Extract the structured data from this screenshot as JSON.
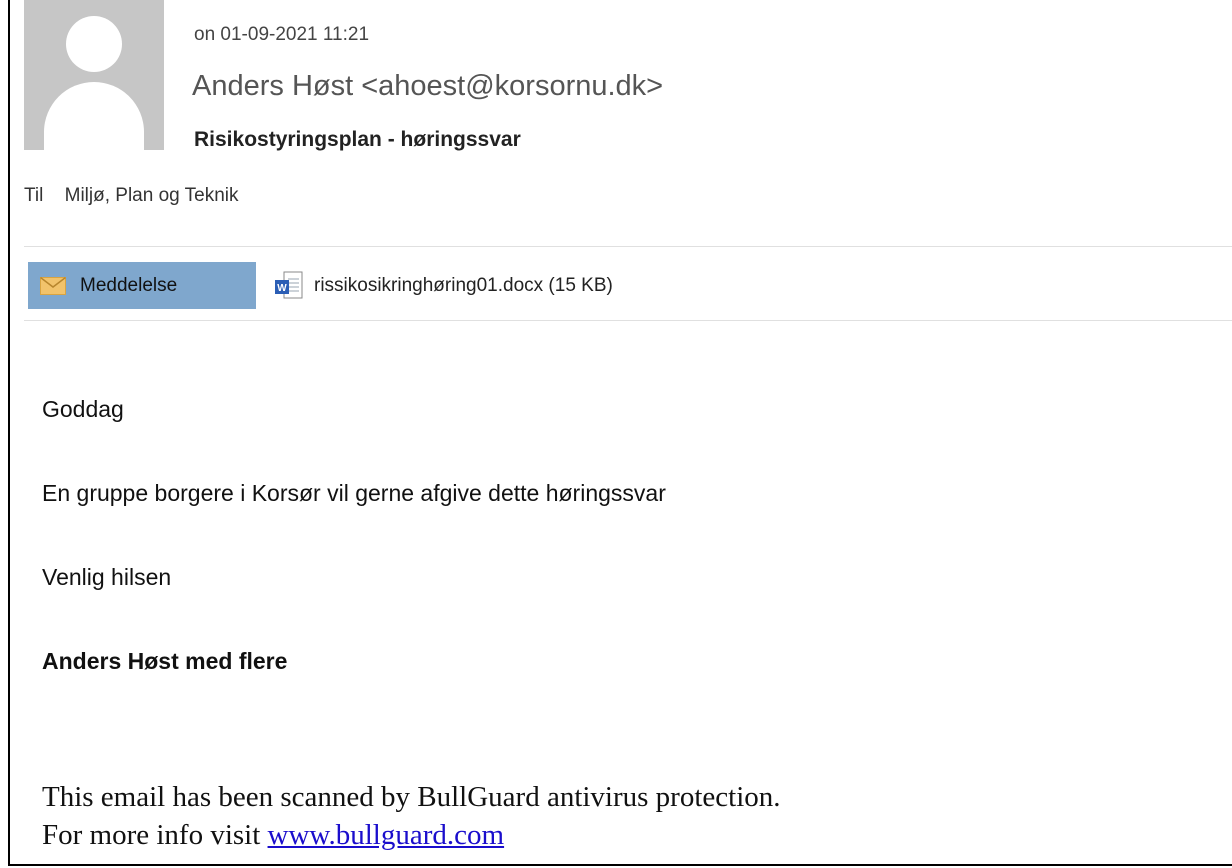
{
  "header": {
    "date": "on 01-09-2021 11:21",
    "sender": "Anders Høst <ahoest@korsornu.dk>",
    "subject": "Risikostyringsplan - høringssvar",
    "to_label": "Til",
    "to_value": "Miljø, Plan og Teknik"
  },
  "tabs": {
    "message_label": "Meddelelse",
    "attachment_label": "rissikosikringhøring01.docx (15 KB)"
  },
  "body": {
    "greeting": "Goddag",
    "line1": "En gruppe borgere i Korsør vil gerne afgive dette høringssvar",
    "closing": "Venlig hilsen",
    "signature": "Anders Høst med flere"
  },
  "footer": {
    "line1": "This email has been scanned by BullGuard antivirus protection.",
    "line2_prefix": "For more info visit ",
    "link_text": "www.bullguard.com"
  },
  "colors": {
    "tab_active": "#7fa7cd",
    "link": "#1a0dcc",
    "avatar_bg": "#c6c6c6"
  },
  "icons": {
    "avatar": "person-silhouette-icon",
    "message": "envelope-icon",
    "attachment": "word-document-icon"
  }
}
